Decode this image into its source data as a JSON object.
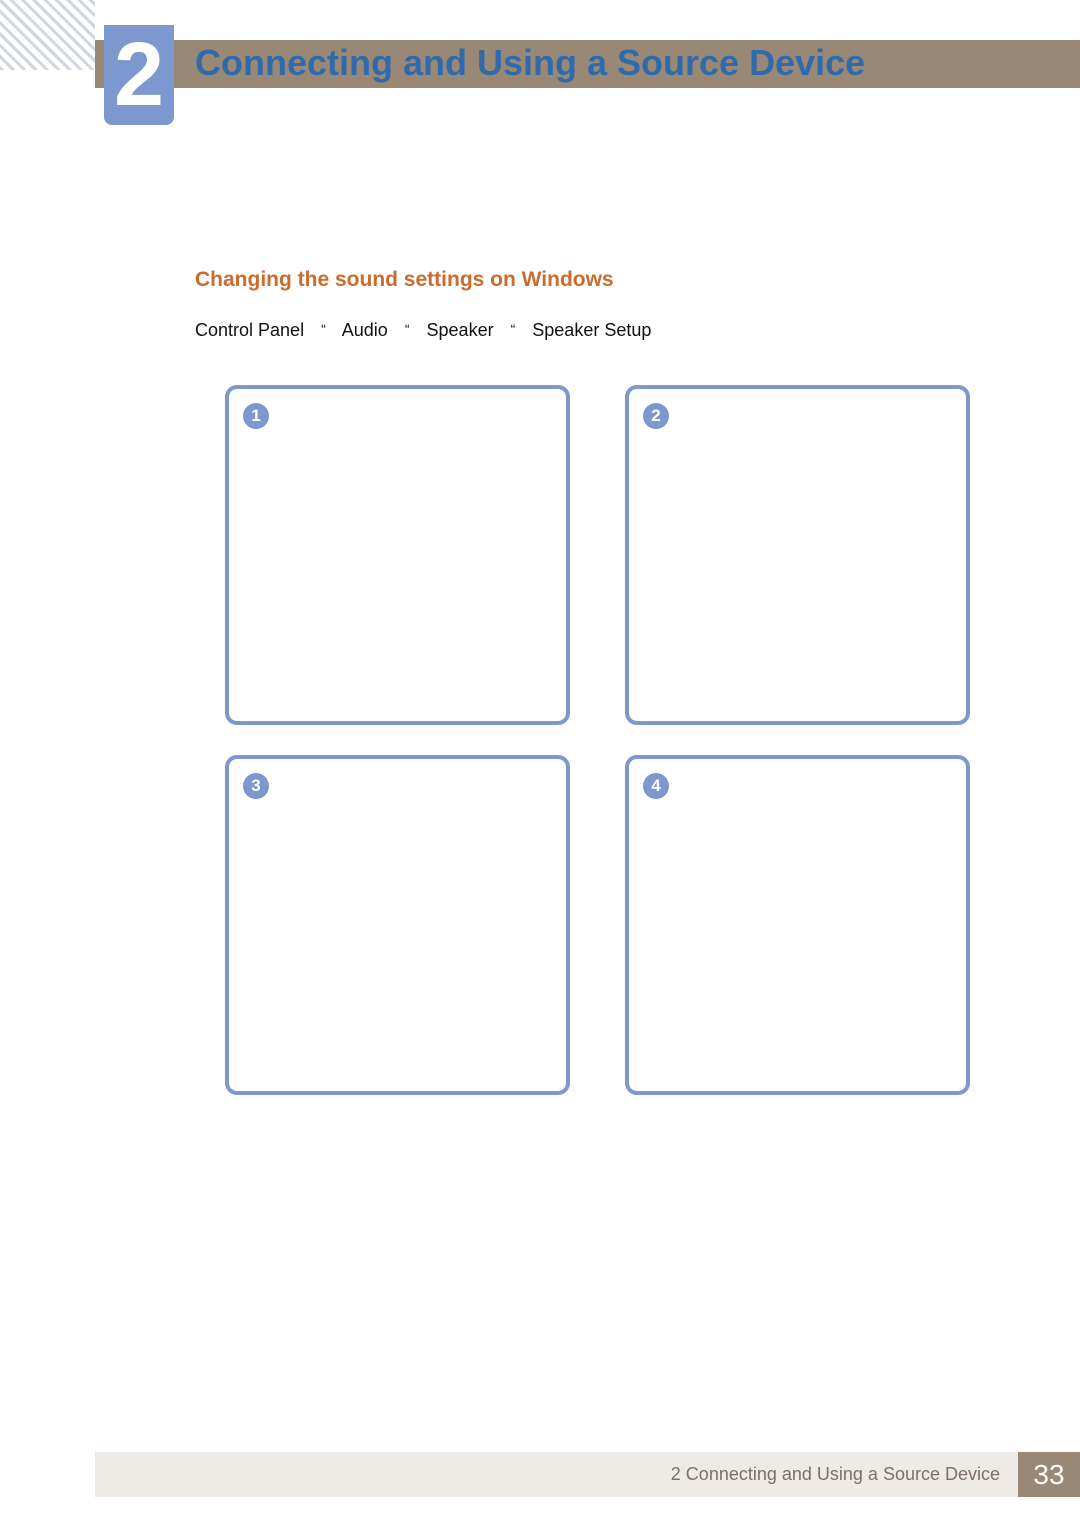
{
  "chapter": {
    "number": "2",
    "title": "Connecting and Using a Source Device"
  },
  "section": {
    "title": "Changing the sound settings on Windows"
  },
  "breadcrumb": {
    "items": [
      "Control Panel",
      "Audio",
      "Speaker",
      "Speaker Setup"
    ],
    "sep": "“"
  },
  "shots": [
    {
      "badge": "1"
    },
    {
      "badge": "2"
    },
    {
      "badge": "3"
    },
    {
      "badge": "4"
    }
  ],
  "footer": {
    "text": "2 Connecting and Using a Source Device",
    "page": "33"
  }
}
